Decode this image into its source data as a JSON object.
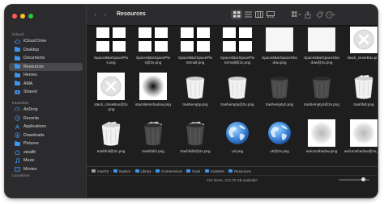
{
  "window": {
    "title": "Resources"
  },
  "sidebar": {
    "sections": [
      {
        "header": "iCloud",
        "items": [
          {
            "label": "iCloud Drive",
            "icon": "cloud-icon"
          },
          {
            "label": "Desktop",
            "icon": "folder-icon"
          },
          {
            "label": "Documents",
            "icon": "folder-icon"
          },
          {
            "label": "Resources",
            "icon": "folder-icon"
          },
          {
            "label": "Heroes",
            "icon": "folder-icon"
          },
          {
            "label": "AMA",
            "icon": "folder-icon"
          },
          {
            "label": "Shared",
            "icon": "shared-folder-icon"
          }
        ]
      },
      {
        "header": "Favorites",
        "items": [
          {
            "label": "AirDrop",
            "icon": "airdrop-icon"
          },
          {
            "label": "Recents",
            "icon": "clock-icon"
          },
          {
            "label": "Applications",
            "icon": "applications-icon"
          },
          {
            "label": "Downloads",
            "icon": "download-icon"
          },
          {
            "label": "Pictures",
            "icon": "folder-icon"
          },
          {
            "label": "stealth",
            "icon": "home-icon"
          },
          {
            "label": "Music",
            "icon": "music-icon"
          },
          {
            "label": "Movies",
            "icon": "film-icon"
          }
        ]
      },
      {
        "header": "Locations",
        "items": []
      }
    ]
  },
  "toolbar": {
    "back": "‹",
    "forward": "›",
    "title": "Resources",
    "view_icons": [
      "icon-view-icon",
      "list-view-icon",
      "column-view-icon",
      "gallery-view-icon"
    ],
    "action_icons": [
      "group-menu-icon",
      "share-icon",
      "tag-icon",
      "more-icon"
    ]
  },
  "files": [
    {
      "name": "SpacesBarSpacePlus.png",
      "caption": "SpacesBarSpacePlu\ns.png",
      "thumb": "plus-black"
    },
    {
      "name": "SpacesBarSpacePlus@2x.png",
      "caption": "SpacesBarSpacePlu\ns@2x.png",
      "thumb": "plus-black"
    },
    {
      "name": "SpacesBarSpaceSmall.png",
      "caption": "SpacesBarSpacePlu\nsSmall.png",
      "thumb": "plus-black"
    },
    {
      "name": "SpacesBarSpaceSmall@2x.png",
      "caption": "SpacesBarSpacePlu\nsSmall@2x.png",
      "thumb": "plus-black"
    },
    {
      "name": "SpacesBarSpaceShadow.png",
      "caption": "SpacesBarSpaceSha\ndow.png",
      "thumb": "white-square"
    },
    {
      "name": "SpacesBarSpaceShadow@2x.png",
      "caption": "SpacesBarSpaceSha\ndow@2x.png",
      "thumb": "white-square"
    },
    {
      "name": "stack_closeBox.png",
      "caption": "stack_closeBox.png",
      "thumb": "close-circle"
    },
    {
      "name": "stack_closeBox@2x.png",
      "caption": "stack_closeBox@2x\n.png",
      "thumb": "close-circle"
    },
    {
      "name": "stackitemshadow.png",
      "caption": "stackitemshadow.png",
      "thumb": "shadow-blur"
    },
    {
      "name": "trashempty.png",
      "caption": "trashempty.png",
      "thumb": "trash-empty"
    },
    {
      "name": "trashempty@2x.png",
      "caption": "trashempty@2x.png",
      "thumb": "trash-empty"
    },
    {
      "name": "trashempty2.png",
      "caption": "trashempty2.png",
      "thumb": "trash-dark"
    },
    {
      "name": "trashempty2@2x.png",
      "caption": "trashempty2@2x.png",
      "thumb": "trash-dark"
    },
    {
      "name": "trashfull.png",
      "caption": "trashfull.png",
      "thumb": "trash-full"
    },
    {
      "name": "trashfull@2x.png",
      "caption": "trashfull@2x.png",
      "thumb": "trash-full"
    },
    {
      "name": "trashfull2.png",
      "caption": "trashfull2.png",
      "thumb": "trash-full-dark"
    },
    {
      "name": "trashfull2@2x.png",
      "caption": "trashfull2@2x.png",
      "thumb": "trash-full-dark"
    },
    {
      "name": "url.png",
      "caption": "url.png",
      "thumb": "globe"
    },
    {
      "name": "url@2x.png",
      "caption": "url@2x.png",
      "thumb": "globe"
    },
    {
      "name": "wvlconshadow.png",
      "caption": "wvlconshadow.png",
      "thumb": "soft-shadow"
    },
    {
      "name": "wvlconshadow@2x.png",
      "caption": "wvlconshadow@2x.png",
      "thumb": "soft-shadow"
    }
  ],
  "pathbar": {
    "items": [
      {
        "label": "macOS",
        "icon": "disk-icon"
      },
      {
        "label": "System",
        "icon": "folder-icon"
      },
      {
        "label": "Library",
        "icon": "folder-icon"
      },
      {
        "label": "CoreServices",
        "icon": "folder-icon"
      },
      {
        "label": "Dock",
        "icon": "app-icon"
      },
      {
        "label": "Contents",
        "icon": "folder-icon"
      },
      {
        "label": "Resources",
        "icon": "folder-icon"
      }
    ],
    "separator": "›"
  },
  "status": {
    "text": "222 items, 213.75 GB available"
  },
  "icon_size_slider": {
    "value": 0.8
  },
  "colors": {
    "accent": "#3d95ee",
    "sidebar_bg": "#2b2a2c",
    "content_bg": "#1e1e1e"
  }
}
